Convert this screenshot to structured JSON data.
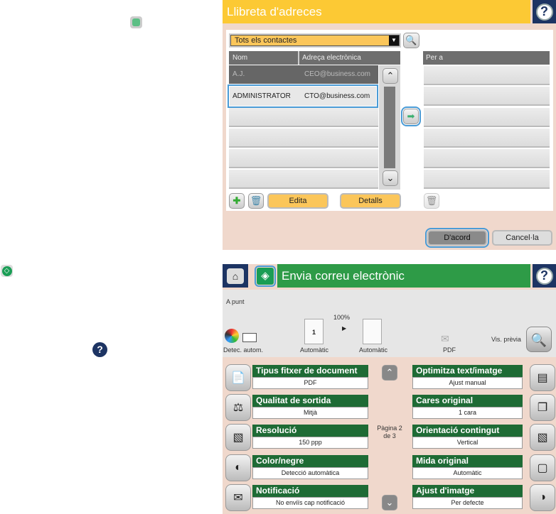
{
  "address_book": {
    "title": "Llibreta d'adreces",
    "filter": "Tots els contactes",
    "col_name": "Nom",
    "col_email": "Adreça electrònica",
    "col_to": "Per a",
    "contacts": [
      {
        "name": "A.J.",
        "email": "CEO@business.com"
      },
      {
        "name": "ADMINISTRATOR",
        "email": "CTO@business.com"
      }
    ],
    "edit": "Edita",
    "details": "Detalls",
    "ok": "D'acord",
    "cancel": "Cancel·la"
  },
  "email": {
    "title": "Envia correu electrònic",
    "status": "A punt",
    "zoom": "100%",
    "color_label": "Detec. autom.",
    "orig_label": "Automàtic",
    "dest_label": "Automàtic",
    "format_label": "PDF",
    "preview": "Vis. prèvia",
    "page": "Pàgina 2 de 3",
    "left": [
      {
        "t": "Tipus fitxer de document",
        "v": "PDF"
      },
      {
        "t": "Qualitat de sortida",
        "v": "Mitjà"
      },
      {
        "t": "Resolució",
        "v": "150 ppp"
      },
      {
        "t": "Color/negre",
        "v": "Detecció automàtica"
      },
      {
        "t": "Notificació",
        "v": "No enviïs cap notificació"
      }
    ],
    "right": [
      {
        "t": "Optimitza text/imatge",
        "v": "Ajust manual"
      },
      {
        "t": "Cares original",
        "v": "1 cara"
      },
      {
        "t": "Orientació contingut",
        "v": "Vertical"
      },
      {
        "t": "Mida original",
        "v": "Automàtic"
      },
      {
        "t": "Ajust d'imatge",
        "v": "Per defecte"
      }
    ]
  },
  "colors": {
    "yellow": "#fcc934",
    "green": "#2e9b47",
    "navy": "#1d3463",
    "pink": "#f0d8cc"
  }
}
